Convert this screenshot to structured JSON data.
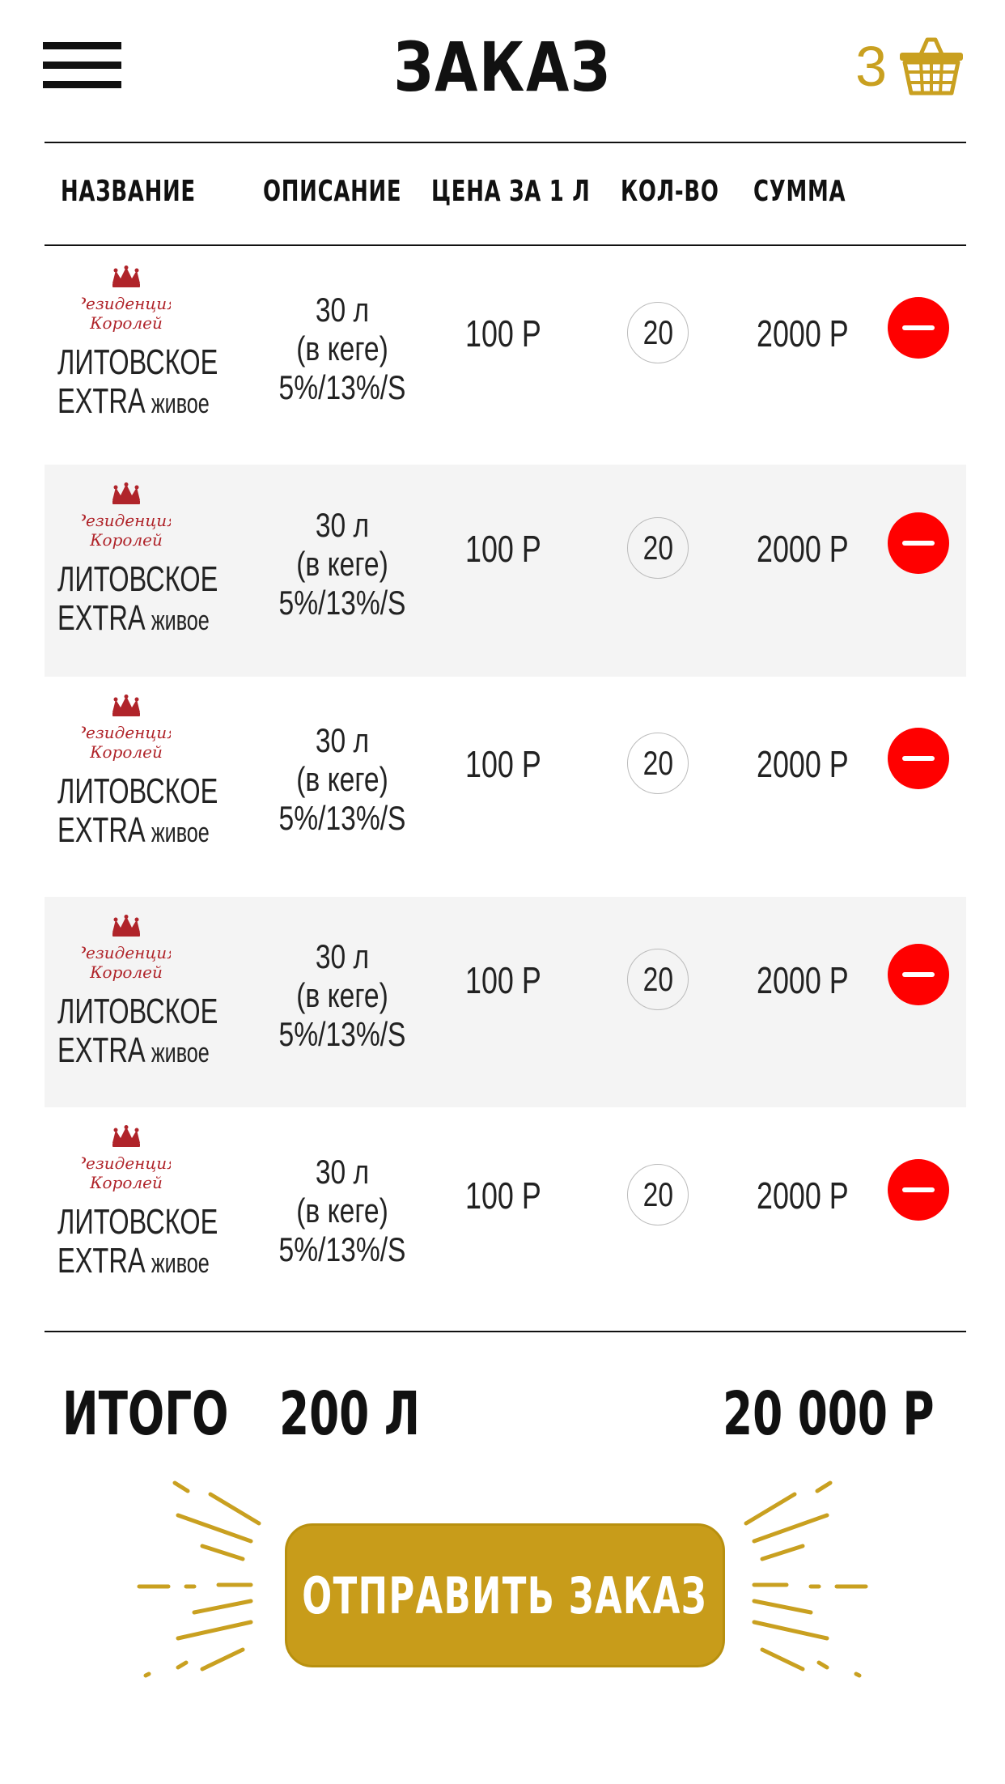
{
  "header": {
    "title": "ЗАКАЗ",
    "cart_count": "3"
  },
  "table": {
    "columns": [
      "НАЗВАНИЕ",
      "ОПИСАНИЕ",
      "ЦЕНА ЗА 1 Л",
      "КОЛ-ВО",
      "СУММА"
    ],
    "rows": [
      {
        "name_main": "ЛИТОВСКОЕ",
        "name_line2": "EXTRA",
        "name_small": "живое",
        "desc_1": "30 л",
        "desc_2": "(в кеге)",
        "desc_3": "5%/13%/S",
        "price": "100 Р",
        "qty": "20",
        "sum": "2000 Р"
      },
      {
        "name_main": "ЛИТОВСКОЕ",
        "name_line2": "EXTRA",
        "name_small": "живое",
        "desc_1": "30 л",
        "desc_2": "(в кеге)",
        "desc_3": "5%/13%/S",
        "price": "100 Р",
        "qty": "20",
        "sum": "2000 Р"
      },
      {
        "name_main": "ЛИТОВСКОЕ",
        "name_line2": "EXTRA",
        "name_small": "живое",
        "desc_1": "30 л",
        "desc_2": "(в кеге)",
        "desc_3": "5%/13%/S",
        "price": "100 Р",
        "qty": "20",
        "sum": "2000 Р"
      },
      {
        "name_main": "ЛИТОВСКОЕ",
        "name_line2": "EXTRA",
        "name_small": "живое",
        "desc_1": "30 л",
        "desc_2": "(в кеге)",
        "desc_3": "5%/13%/S",
        "price": "100 Р",
        "qty": "20",
        "sum": "2000 Р"
      },
      {
        "name_main": "ЛИТОВСКОЕ",
        "name_line2": "EXTRA",
        "name_small": "живое",
        "desc_1": "30 л",
        "desc_2": "(в кеге)",
        "desc_3": "5%/13%/S",
        "price": "100 Р",
        "qty": "20",
        "sum": "2000 Р"
      }
    ]
  },
  "brand_logo": {
    "text": "Резиденция Королей",
    "icon": "crown-icon"
  },
  "totals": {
    "label": "ИТОГО",
    "volume": "200 Л",
    "sum": "20 000 Р"
  },
  "cta": {
    "label": "ОТПРАВИТЬ ЗАКАЗ"
  },
  "colors": {
    "accent": "#c89c1a",
    "remove": "#ff0000",
    "alt_row": "#f4f4f4",
    "logo_red": "#b0242a"
  },
  "icons": [
    "hamburger-icon",
    "basket-icon",
    "crown-icon",
    "minus-icon"
  ]
}
